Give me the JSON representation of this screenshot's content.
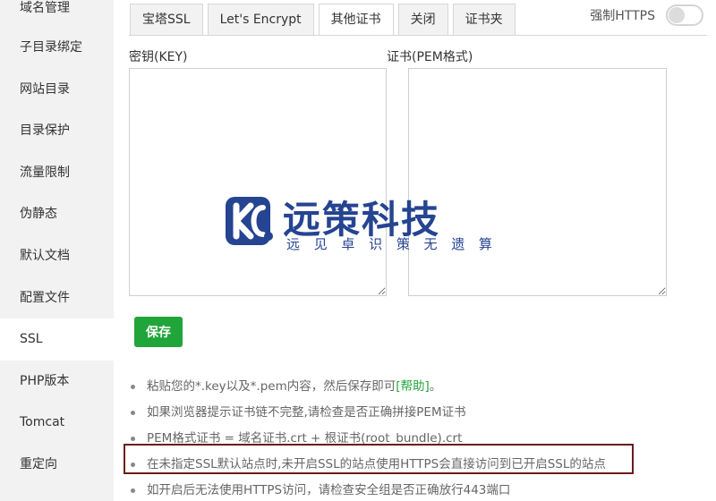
{
  "sidebar": {
    "items": [
      {
        "label": "域名管理"
      },
      {
        "label": "子目录绑定"
      },
      {
        "label": "网站目录"
      },
      {
        "label": "目录保护"
      },
      {
        "label": "流量限制"
      },
      {
        "label": "伪静态"
      },
      {
        "label": "默认文档"
      },
      {
        "label": "配置文件"
      },
      {
        "label": "SSL"
      },
      {
        "label": "PHP版本"
      },
      {
        "label": "Tomcat"
      },
      {
        "label": "重定向"
      }
    ],
    "active": "SSL"
  },
  "tabs": [
    {
      "label": "宝塔SSL"
    },
    {
      "label": "Let's Encrypt"
    },
    {
      "label": "其他证书"
    },
    {
      "label": "关闭"
    },
    {
      "label": "证书夹"
    }
  ],
  "active_tab": "其他证书",
  "force_https": {
    "label": "强制HTTPS",
    "enabled": false
  },
  "key_field": {
    "label": "密钥(KEY)",
    "value": ""
  },
  "cert_field": {
    "label": "证书(PEM格式)",
    "value": ""
  },
  "save_button": {
    "label": "保存"
  },
  "tips": {
    "t1": "粘贴您的*.key以及*.pem内容，然后保存即可",
    "t1_link": "[帮助]",
    "t1_end": "。",
    "t2": "如果浏览器提示证书链不完整,请检查是否正确拼接PEM证书",
    "t3": "PEM格式证书 = 域名证书.crt + 根证书(root_bundle).crt",
    "t4": "在未指定SSL默认站点时,未开启SSL的站点使用HTTPS会直接访问到已开启SSL的站点",
    "t5": "如开启后无法使用HTTPS访问，请检查安全组是否正确放行443端口"
  },
  "watermark": {
    "title": "远策科技",
    "sub": [
      "远",
      "见",
      "卓",
      "识",
      "策",
      "无",
      "遗",
      "算"
    ],
    "logo_icon": "company-logo-icon",
    "color": "#1a3a8c"
  },
  "colors": {
    "accent": "#20a53a",
    "highlight_border": "#6b1b1b"
  }
}
